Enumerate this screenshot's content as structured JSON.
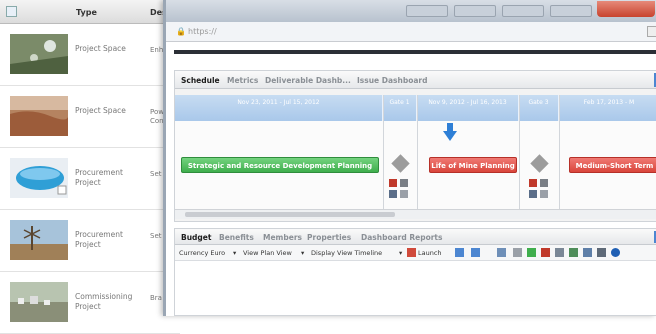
{
  "list": {
    "header": {
      "type": "Type",
      "desc": "Des"
    },
    "rows": [
      {
        "type": "Project Space",
        "desc": "Enh",
        "thumb": "aerial-site"
      },
      {
        "type": "Project Space",
        "desc": "Pow Con",
        "thumb": "desert-mine"
      },
      {
        "type": "Procurement Project",
        "desc": "Set",
        "thumb": "blue-tank"
      },
      {
        "type": "Procurement Project",
        "desc": "Set",
        "thumb": "windmill"
      },
      {
        "type": "Commissioning Project",
        "desc": "Bra pro",
        "thumb": "town"
      }
    ]
  },
  "browser": {
    "url": "https://"
  },
  "schedule": {
    "tabs": [
      "Schedule",
      "Metrics",
      "Deliverable Dashb...",
      "Issue Dashboard"
    ],
    "active_tab": "Schedule",
    "timeline": [
      {
        "label": "Nov 23, 2011 - Jul 15, 2012"
      },
      {
        "label": "Gate 1"
      },
      {
        "label": "Nov 9, 2012 - Jul 16, 2013"
      },
      {
        "label": "Gate 3"
      },
      {
        "label": "Feb 17, 2013 - M"
      }
    ],
    "bars": [
      {
        "label": "Strategic and Resource Development Planning",
        "color": "#3fae4d"
      },
      {
        "label": "Life of Mine Planning",
        "color": "#d9453b"
      },
      {
        "label": "Medium-Short Term",
        "color": "#d9453b"
      }
    ]
  },
  "details": {
    "tabs": [
      "Budget",
      "Benefits",
      "Members",
      "Properties",
      "Dashboard Reports"
    ],
    "active_tab": "Budget",
    "toolbar": {
      "currency": "Currency Euro",
      "view": "View Plan View",
      "display": "Display View Timeline",
      "launch": "Launch"
    }
  },
  "colors": {
    "accent": "#4c86d1",
    "timeline": "#a9c8ea",
    "green": "#3fae4d",
    "red": "#d9453b"
  }
}
